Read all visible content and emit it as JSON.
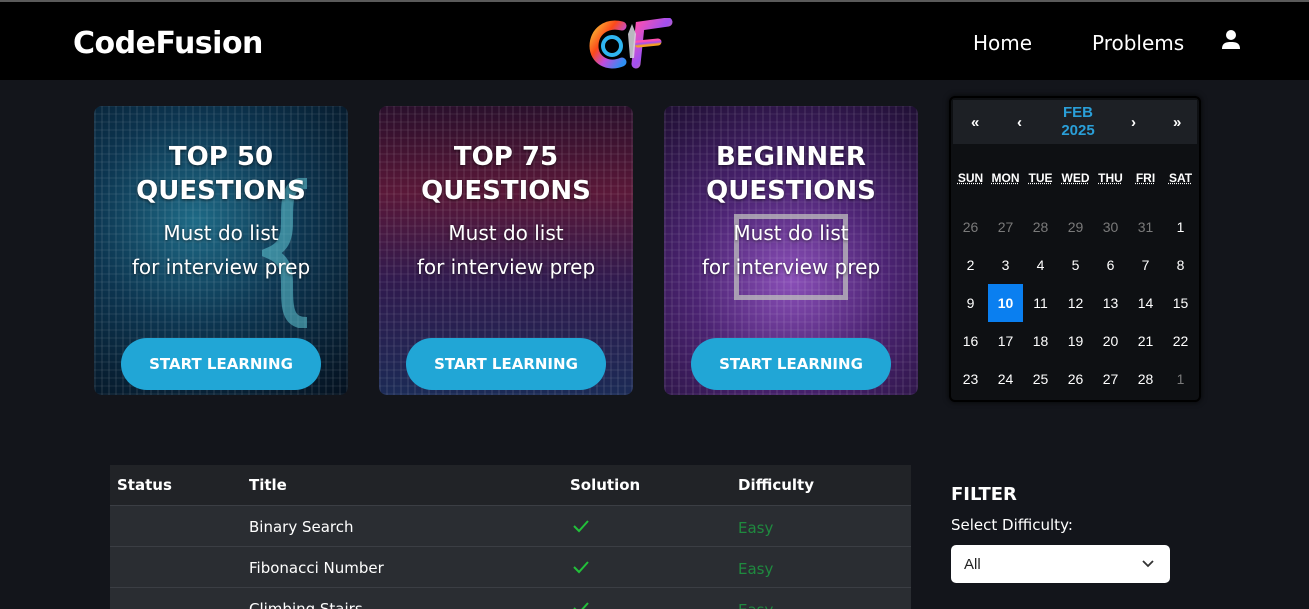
{
  "nav": {
    "brand": "CodeFusion",
    "logo_text": "CF",
    "links": [
      "Home",
      "Problems"
    ],
    "user_icon": "user-icon"
  },
  "cards": [
    {
      "title_line1": "TOP 50",
      "title_line2": "QUESTIONS",
      "sub_line1": "Must do list",
      "sub_line2": "for interview prep",
      "button": "START LEARNING"
    },
    {
      "title_line1": "TOP 75",
      "title_line2": "QUESTIONS",
      "sub_line1": "Must do list",
      "sub_line2": "for interview prep",
      "button": "START LEARNING"
    },
    {
      "title_line1": "BEGINNER",
      "title_line2": "QUESTIONS",
      "sub_line1": "Must do list",
      "sub_line2": "for interview prep",
      "button": "START LEARNING"
    }
  ],
  "calendar": {
    "month": "FEB",
    "year": "2025",
    "prev_year": "«",
    "prev_month": "‹",
    "next_month": "›",
    "next_year": "»",
    "weekdays": [
      "SUN",
      "MON",
      "TUE",
      "WED",
      "THU",
      "FRI",
      "SAT"
    ],
    "weeks": [
      [
        "26",
        "27",
        "28",
        "29",
        "30",
        "31",
        "1"
      ],
      [
        "2",
        "3",
        "4",
        "5",
        "6",
        "7",
        "8"
      ],
      [
        "9",
        "10",
        "11",
        "12",
        "13",
        "14",
        "15"
      ],
      [
        "16",
        "17",
        "18",
        "19",
        "20",
        "21",
        "22"
      ],
      [
        "23",
        "24",
        "25",
        "26",
        "27",
        "28",
        "1"
      ]
    ],
    "selected_day": "10",
    "accent_color": "#0a7ff0"
  },
  "table": {
    "headers": {
      "status": "Status",
      "title": "Title",
      "solution": "Solution",
      "difficulty": "Difficulty"
    },
    "rows": [
      {
        "title": "Binary Search",
        "difficulty": "Easy"
      },
      {
        "title": "Fibonacci Number",
        "difficulty": "Easy"
      },
      {
        "title": "Climbing Stairs",
        "difficulty": "Easy"
      }
    ],
    "easy_color": "#1f8a3f",
    "check_color": "#22c03a"
  },
  "filter": {
    "title": "FILTER",
    "label": "Select Difficulty:",
    "selected": "All"
  }
}
